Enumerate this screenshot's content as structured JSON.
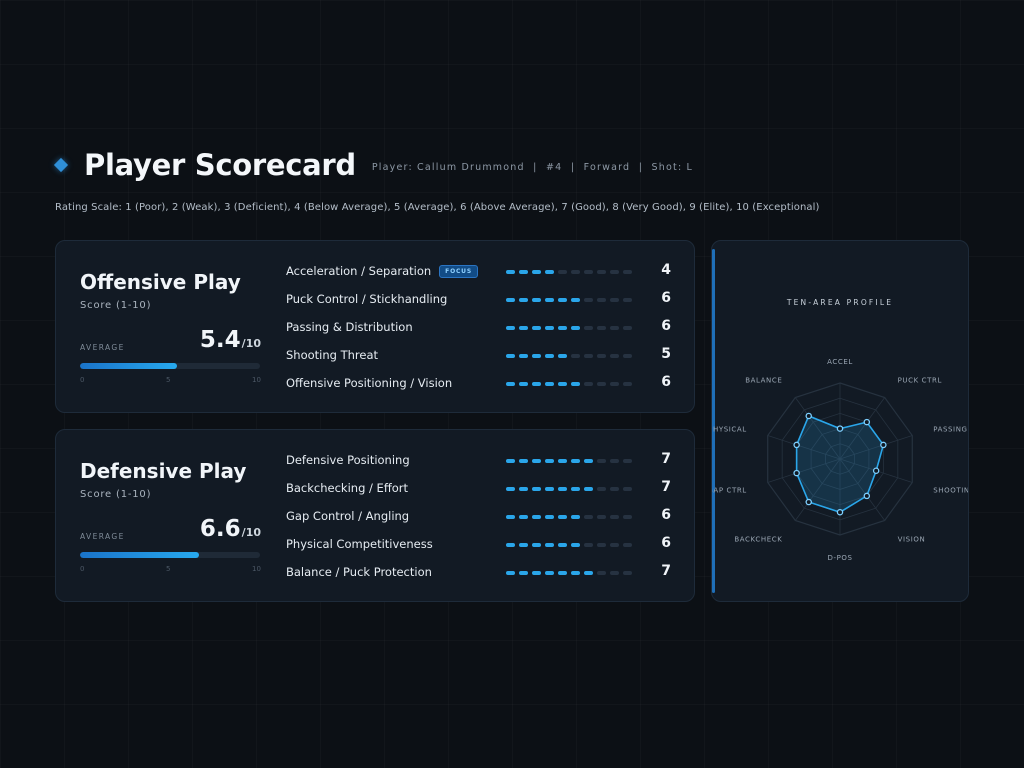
{
  "header": {
    "title": "Player Scorecard",
    "subtitle": "Player: Callum Drummond  |  #4  |  Forward  |  Shot: L"
  },
  "rating_scale": "Rating Scale: 1 (Poor), 2 (Weak), 3 (Deficient), 4 (Below Average), 5 (Average), 6 (Above Average), 7 (Good), 8 (Very Good), 9 (Elite), 10 (Exceptional)",
  "offensive": {
    "title": "Offensive Play",
    "score_label": "Score (1-10)",
    "average_label": "AVERAGE",
    "average": "5.4",
    "average_value": 5.4,
    "denominator": "/10",
    "ticks": [
      "0",
      "5",
      "10"
    ],
    "items": [
      {
        "label": "Acceleration / Separation",
        "score": 4,
        "score_text": "4",
        "badge": "FOCUS"
      },
      {
        "label": "Puck Control / Stickhandling",
        "score": 6,
        "score_text": "6"
      },
      {
        "label": "Passing & Distribution",
        "score": 6,
        "score_text": "6"
      },
      {
        "label": "Shooting Threat",
        "score": 5,
        "score_text": "5"
      },
      {
        "label": "Offensive Positioning / Vision",
        "score": 6,
        "score_text": "6"
      }
    ]
  },
  "defensive": {
    "title": "Defensive Play",
    "score_label": "Score (1-10)",
    "average_label": "AVERAGE",
    "average": "6.6",
    "average_value": 6.6,
    "denominator": "/10",
    "ticks": [
      "0",
      "5",
      "10"
    ],
    "items": [
      {
        "label": "Defensive Positioning",
        "score": 7,
        "score_text": "7"
      },
      {
        "label": "Backchecking / Effort",
        "score": 7,
        "score_text": "7"
      },
      {
        "label": "Gap Control / Angling",
        "score": 6,
        "score_text": "6"
      },
      {
        "label": "Physical Competitiveness",
        "score": 6,
        "score_text": "6"
      },
      {
        "label": "Balance / Puck Protection",
        "score": 7,
        "score_text": "7"
      }
    ]
  },
  "radar": {
    "title": "TEN-AREA PROFILE",
    "axes": [
      "ACCEL",
      "PUCK CTRL",
      "PASSING",
      "SHOOTING",
      "VISION",
      "D-POS",
      "BACKCHECK",
      "GAP CTRL",
      "PHYSICAL",
      "BALANCE"
    ],
    "values": [
      4,
      6,
      6,
      5,
      6,
      7,
      7,
      6,
      6,
      7
    ],
    "max": 10,
    "rings": 5,
    "colors": {
      "accent": "#2aa6ea",
      "fill": "rgba(42,166,234,0.18)",
      "grid": "#26323f"
    }
  }
}
